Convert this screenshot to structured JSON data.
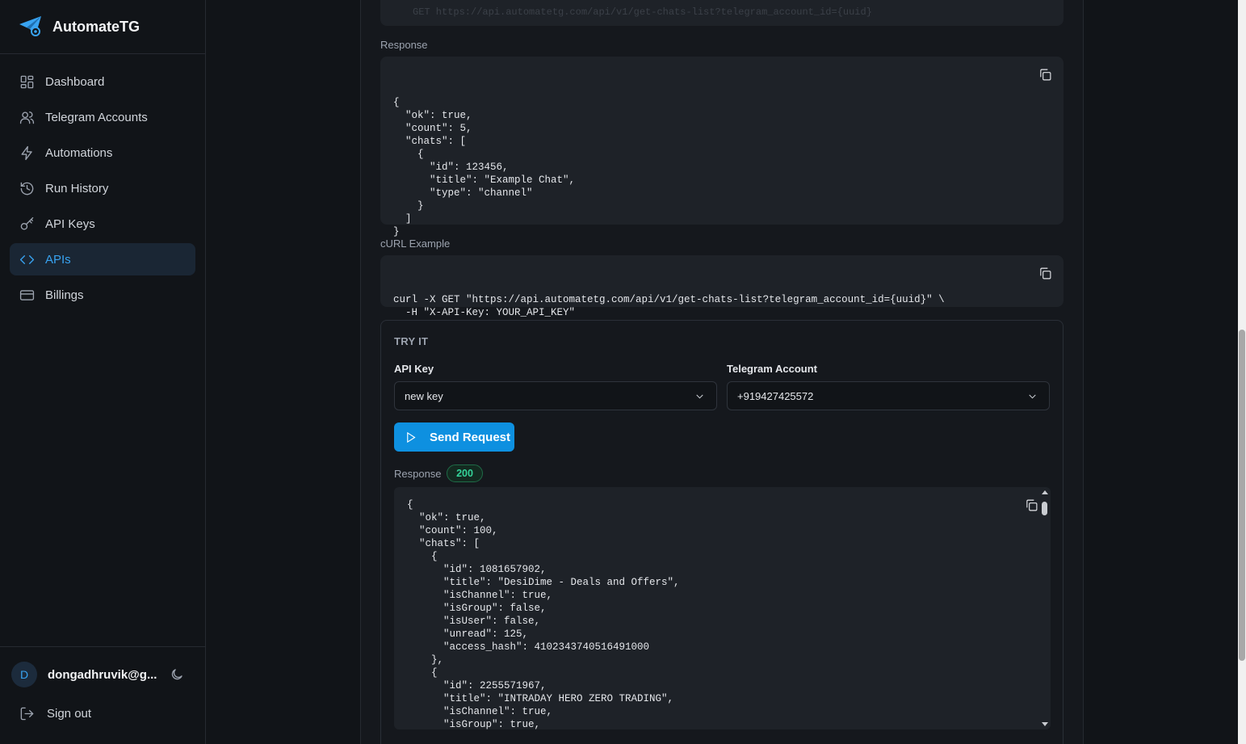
{
  "app": {
    "name": "AutomateTG",
    "brand_color": "#38a3f1"
  },
  "sidebar": {
    "items": [
      {
        "label": "Dashboard",
        "icon": "grid-icon",
        "active": false
      },
      {
        "label": "Telegram Accounts",
        "icon": "users-icon",
        "active": false
      },
      {
        "label": "Automations",
        "icon": "bolt-icon",
        "active": false
      },
      {
        "label": "Run History",
        "icon": "history-icon",
        "active": false
      },
      {
        "label": "API Keys",
        "icon": "key-icon",
        "active": false
      },
      {
        "label": "APIs",
        "icon": "code-icon",
        "active": true
      },
      {
        "label": "Billings",
        "icon": "card-icon",
        "active": false
      }
    ],
    "user": {
      "avatar_letter": "D",
      "email": "dongadhruvik@g..."
    },
    "signout_label": "Sign out"
  },
  "main": {
    "top_url": "GET  https://api.automatetg.com/api/v1/get-chats-list?telegram_account_id={uuid}",
    "example_response_label": "Response",
    "example_response": "{\n  \"ok\": true,\n  \"count\": 5,\n  \"chats\": [\n    {\n      \"id\": 123456,\n      \"title\": \"Example Chat\",\n      \"type\": \"channel\"\n    }\n  ]\n}",
    "curl_label": "cURL Example",
    "curl": "curl -X GET \"https://api.automatetg.com/api/v1/get-chats-list?telegram_account_id={uuid}\" \\\n  -H \"X-API-Key: YOUR_API_KEY\"",
    "try_it": {
      "title": "TRY IT",
      "api_key_label": "API Key",
      "api_key_value": "new key",
      "account_label": "Telegram Account",
      "account_value": "+919427425572",
      "send_label": "Send Request",
      "response_label": "Response",
      "status_code": "200",
      "response_body": "{\n  \"ok\": true,\n  \"count\": 100,\n  \"chats\": [\n    {\n      \"id\": 1081657902,\n      \"title\": \"DesiDime - Deals and Offers\",\n      \"isChannel\": true,\n      \"isGroup\": false,\n      \"isUser\": false,\n      \"unread\": 125,\n      \"access_hash\": 4102343740516491000\n    },\n    {\n      \"id\": 2255571967,\n      \"title\": \"INTRADAY HERO ZERO TRADING\",\n      \"isChannel\": true,\n      \"isGroup\": true,"
    }
  }
}
